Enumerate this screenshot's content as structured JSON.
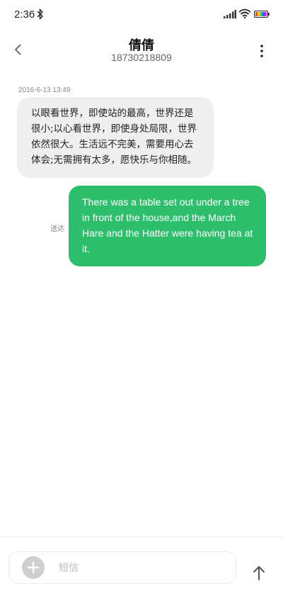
{
  "status_bar": {
    "time": "2:36",
    "icons": [
      "bluetooth-icon",
      "signal-icon",
      "wifi-icon",
      "battery-icon"
    ]
  },
  "header": {
    "contact_name": "倩倩",
    "contact_number": "18730218809",
    "icons": [
      "back-arrow-icon",
      "more-vertical-icon"
    ]
  },
  "conversation": {
    "timestamp": "2016-6-13 13:49",
    "incoming_message": "以眼看世界，即使站的最高，世界还是很小;以心看世界，即使身处局限，世界依然很大。生活远不完美，需要用心去体会;无需拥有太多，愿快乐与你相随。",
    "outgoing_message": "There was a table set out under a tree in front of the house,and the March Hare and the Hatter were having tea at it.",
    "outgoing_status": "送达"
  },
  "composer": {
    "placeholder": "短信",
    "value": "",
    "icons": [
      "plus-icon",
      "send-arrow-icon"
    ]
  },
  "colors": {
    "outgoing_bubble": "#2dbf6c",
    "incoming_bubble": "#efefef"
  }
}
